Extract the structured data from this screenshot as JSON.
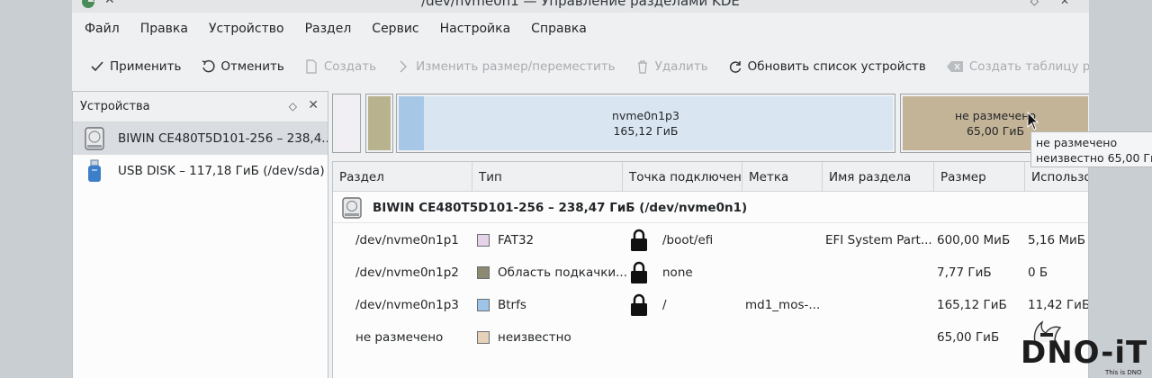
{
  "window": {
    "title": "/dev/nvme0n1 — Управление разделами KDE"
  },
  "menu": [
    "Файл",
    "Правка",
    "Устройство",
    "Раздел",
    "Сервис",
    "Настройка",
    "Справка"
  ],
  "toolbar": {
    "apply": "Применить",
    "undo": "Отменить",
    "create": "Создать",
    "resize": "Изменить размер/переместить",
    "delete": "Удалить",
    "refresh": "Обновить список устройств",
    "create_table": "Создать таблицу разделов"
  },
  "devices": {
    "title": "Устройства",
    "items": [
      {
        "label": "BIWIN CE480T5D101-256 – 238,4...",
        "icon": "hdd-icon",
        "selected": true
      },
      {
        "label": "USB DISK – 117,18 ГиБ (/dev/sda)",
        "icon": "usb-icon",
        "selected": false
      }
    ]
  },
  "partition_bar": {
    "main": {
      "name": "nvme0n1p3",
      "size": "165,12 ГиБ"
    },
    "unallocated": {
      "name": "не размечено",
      "size": "65,00 ГиБ"
    },
    "colors": {
      "efi": "#f2eff4",
      "swap": "#b8b38e",
      "btrfs_edge": "#a6c8e6",
      "btrfs": "#d9e6f2",
      "unallocated": "#c4b497"
    }
  },
  "tooltip": {
    "line1": "не размечено",
    "line2": "неизвестно 65,00 ГиБ"
  },
  "table": {
    "columns": [
      "Раздел",
      "Тип",
      "Точка подключения",
      "Метка",
      "Имя раздела",
      "Размер",
      "Использовано"
    ],
    "disk_label": "BIWIN CE480T5D101-256 – 238,47 ГиБ (/dev/nvme0n1)",
    "rows": [
      {
        "partition": "/dev/nvme0n1p1",
        "type": "FAT32",
        "color": "#e6d3ea",
        "locked": true,
        "mount": "/boot/efi",
        "label": "",
        "name": "EFI System Part...",
        "size": "600,00 МиБ",
        "used": "5,16 МиБ"
      },
      {
        "partition": "/dev/nvme0n1p2",
        "type": "Область подкачки...",
        "color": "#8d8a72",
        "locked": true,
        "mount": "none",
        "label": "",
        "name": "",
        "size": "7,77 ГиБ",
        "used": "0 Б"
      },
      {
        "partition": "/dev/nvme0n1p3",
        "type": "Btrfs",
        "color": "#9ec4e8",
        "locked": true,
        "mount": "/",
        "label": "md1_mos-...",
        "name": "",
        "size": "165,12 ГиБ",
        "used": "11,42 ГиБ"
      },
      {
        "partition": "не размечено",
        "type": "неизвестно",
        "color": "#e5d2b8",
        "locked": false,
        "mount": "",
        "label": "",
        "name": "",
        "size": "65,00 ГиБ",
        "used": ""
      }
    ]
  },
  "watermark": {
    "text": "DNO-iT",
    "sub": "This is DNO"
  }
}
